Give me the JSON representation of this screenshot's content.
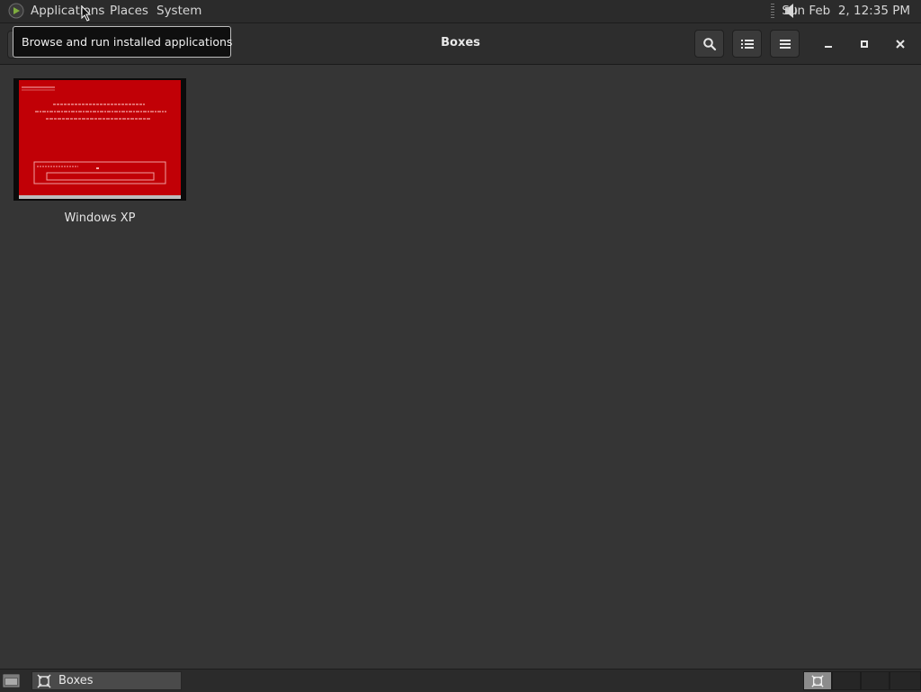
{
  "top_panel": {
    "menus": [
      "Applications",
      "Places",
      "System"
    ],
    "clock": "Sun Feb  2, 12:35 PM"
  },
  "tooltip": "Browse and run installed applications",
  "window": {
    "title": "Boxes"
  },
  "boxes": [
    {
      "name": "Windows XP",
      "thumbnail_color": "#c10006"
    }
  ],
  "taskbar": {
    "tasks": [
      "Boxes"
    ]
  },
  "colors": {
    "background": "#353535",
    "panel": "#2b2b2b",
    "thumbnail_bg": "#c10006"
  }
}
